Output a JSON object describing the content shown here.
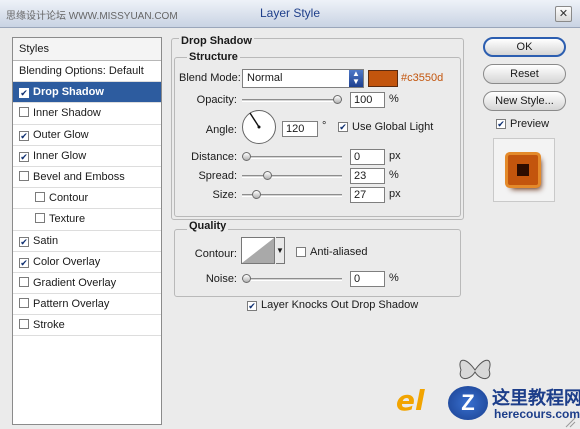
{
  "titlebar": {
    "watermark": "思缘设计论坛 WWW.MISSYUAN.COM",
    "title": "Layer Style",
    "close_glyph": "✕"
  },
  "styles_list": {
    "header": "Styles",
    "items": [
      {
        "label": "Blending Options: Default",
        "checkbox": false,
        "checked": false,
        "indent": false,
        "selected": false
      },
      {
        "label": "Drop Shadow",
        "checkbox": true,
        "checked": true,
        "indent": false,
        "selected": true
      },
      {
        "label": "Inner Shadow",
        "checkbox": true,
        "checked": false,
        "indent": false,
        "selected": false
      },
      {
        "label": "Outer Glow",
        "checkbox": true,
        "checked": true,
        "indent": false,
        "selected": false
      },
      {
        "label": "Inner Glow",
        "checkbox": true,
        "checked": true,
        "indent": false,
        "selected": false
      },
      {
        "label": "Bevel and Emboss",
        "checkbox": true,
        "checked": false,
        "indent": false,
        "selected": false
      },
      {
        "label": "Contour",
        "checkbox": true,
        "checked": false,
        "indent": true,
        "selected": false
      },
      {
        "label": "Texture",
        "checkbox": true,
        "checked": false,
        "indent": true,
        "selected": false
      },
      {
        "label": "Satin",
        "checkbox": true,
        "checked": true,
        "indent": false,
        "selected": false
      },
      {
        "label": "Color Overlay",
        "checkbox": true,
        "checked": true,
        "indent": false,
        "selected": false
      },
      {
        "label": "Gradient Overlay",
        "checkbox": true,
        "checked": false,
        "indent": false,
        "selected": false
      },
      {
        "label": "Pattern Overlay",
        "checkbox": true,
        "checked": false,
        "indent": false,
        "selected": false
      },
      {
        "label": "Stroke",
        "checkbox": true,
        "checked": false,
        "indent": false,
        "selected": false
      }
    ]
  },
  "drop_shadow": {
    "title": "Drop Shadow",
    "structure": {
      "title": "Structure",
      "blend_mode_label": "Blend Mode:",
      "blend_mode_value": "Normal",
      "shadow_color": "#c3550d",
      "color_text": "#c3550d",
      "opacity_label": "Opacity:",
      "opacity_value": "100",
      "opacity_unit": "%",
      "opacity_level": 1.0,
      "angle_label": "Angle:",
      "angle_value": "120",
      "angle_unit": "°",
      "use_global_light_label": "Use Global Light",
      "use_global_light_checked": true,
      "distance_label": "Distance:",
      "distance_value": "0",
      "distance_unit": "px",
      "distance_level": 0.0,
      "spread_label": "Spread:",
      "spread_value": "23",
      "spread_unit": "%",
      "spread_level": 0.23,
      "size_label": "Size:",
      "size_value": "27",
      "size_unit": "px",
      "size_level": 0.11
    },
    "quality": {
      "title": "Quality",
      "contour_label": "Contour:",
      "anti_aliased_label": "Anti-aliased",
      "anti_aliased_checked": false,
      "noise_label": "Noise:",
      "noise_value": "0",
      "noise_unit": "%",
      "noise_level": 0.0
    },
    "knockout_label": "Layer Knocks Out Drop Shadow",
    "knockout_checked": true
  },
  "buttons": {
    "ok": "OK",
    "reset": "Reset",
    "new_style": "New Style...",
    "preview_label": "Preview",
    "preview_checked": true
  },
  "logo": {
    "el_text": "el",
    "z_text": "Z",
    "chinese": "这里教程网",
    "url": "herecours.com"
  },
  "icons": {
    "dropdown": "dropdown-arrows-icon",
    "butterfly": "butterfly-icon",
    "resize": "resize-grip-icon"
  }
}
